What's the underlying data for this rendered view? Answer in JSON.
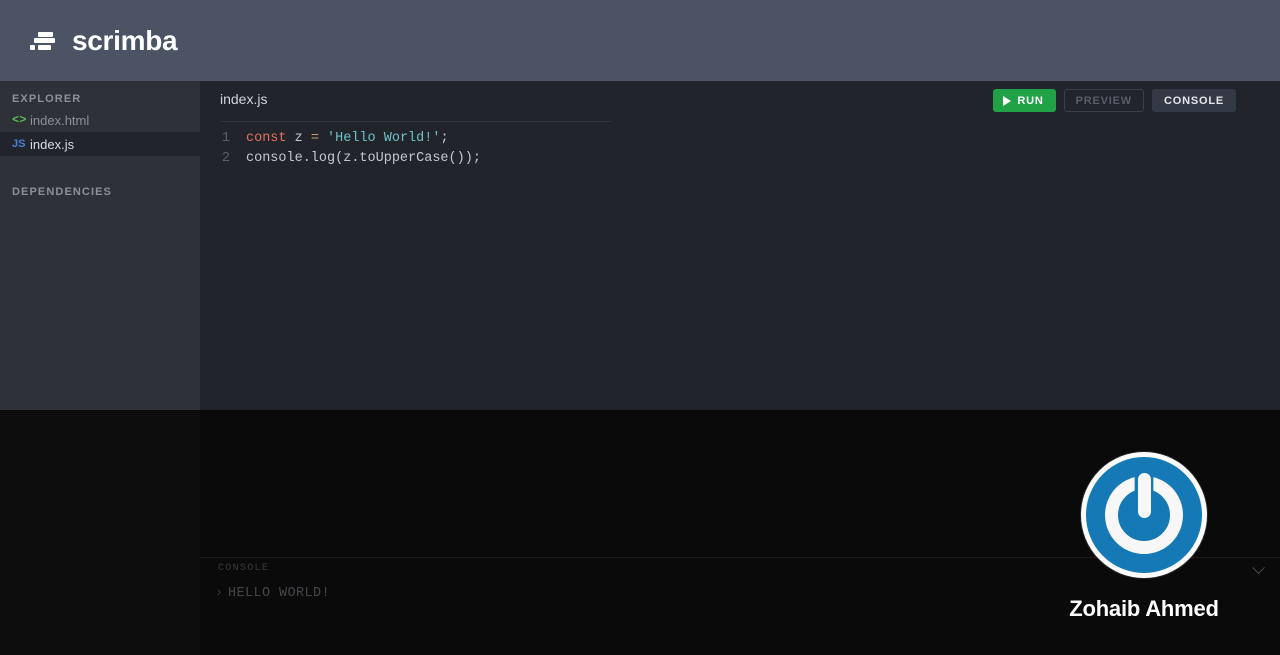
{
  "header": {
    "brand_name": "scrimba",
    "logo_icon": "scrimba-motion-lines-icon",
    "brand_bg": "#4b5364"
  },
  "sidebar": {
    "explorer_label": "EXPLORER",
    "dependencies_label": "DEPENDENCIES",
    "files": [
      {
        "name": "index.html",
        "icon": "html-angle-brackets-icon",
        "icon_glyph": "<>",
        "icon_color": "#5cb85c",
        "active": false
      },
      {
        "name": "index.js",
        "icon": "js-badge-icon",
        "icon_glyph": "JS",
        "icon_color": "#4f7fd6",
        "active": true
      }
    ]
  },
  "editor": {
    "tab_label": "index.js",
    "actions": {
      "run_label": "RUN",
      "run_icon": "play-triangle-icon",
      "run_color": "#21a247",
      "preview_label": "PREVIEW",
      "console_label": "CONSOLE"
    },
    "code": {
      "lines": [
        {
          "number": "1",
          "tokens": [
            {
              "text": "const",
              "type": "kw"
            },
            {
              "text": " z ",
              "type": "pl"
            },
            {
              "text": "=",
              "type": "op"
            },
            {
              "text": " ",
              "type": "pl"
            },
            {
              "text": "'Hello World!'",
              "type": "str"
            },
            {
              "text": ";",
              "type": "pl"
            }
          ]
        },
        {
          "number": "2",
          "tokens": [
            {
              "text": "console.log(z.toUpperCase());",
              "type": "pl"
            }
          ]
        }
      ]
    }
  },
  "console": {
    "title": "CONSOLE",
    "collapse_icon": "chevron-down-icon",
    "output": [
      {
        "caret": "›",
        "message": "HELLO WORLD!"
      }
    ]
  },
  "overlay": {
    "avatar_icon": "power-spiral-avatar-icon",
    "avatar_color": "#1579b5",
    "user_name": "Zohaib Ahmed"
  }
}
